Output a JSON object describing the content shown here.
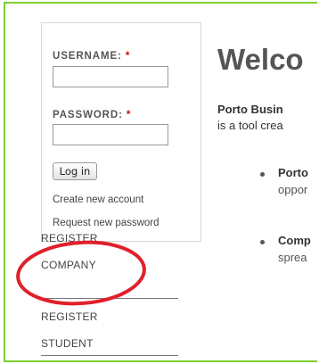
{
  "login": {
    "username_label": "USERNAME:",
    "password_label": "PASSWORD:",
    "required_marker": "*",
    "username_value": "",
    "password_value": "",
    "login_button": "Log in",
    "create_account": "Create new account",
    "request_password": "Request new password"
  },
  "nav": {
    "items": [
      {
        "line1": "REGISTER",
        "line2": "COMPANY"
      },
      {
        "line1": "REGISTER",
        "line2": "STUDENT"
      }
    ]
  },
  "main": {
    "title": "Welco",
    "intro_bold": "Porto Busin",
    "intro_rest": "is a tool crea",
    "bullets": [
      {
        "title": "Porto",
        "text": "oppor"
      },
      {
        "title": "Comp",
        "text": "sprea"
      }
    ]
  },
  "colors": {
    "frame_border": "#7ccf2e",
    "highlight_circle": "#e0202a",
    "required": "#cc0000"
  }
}
